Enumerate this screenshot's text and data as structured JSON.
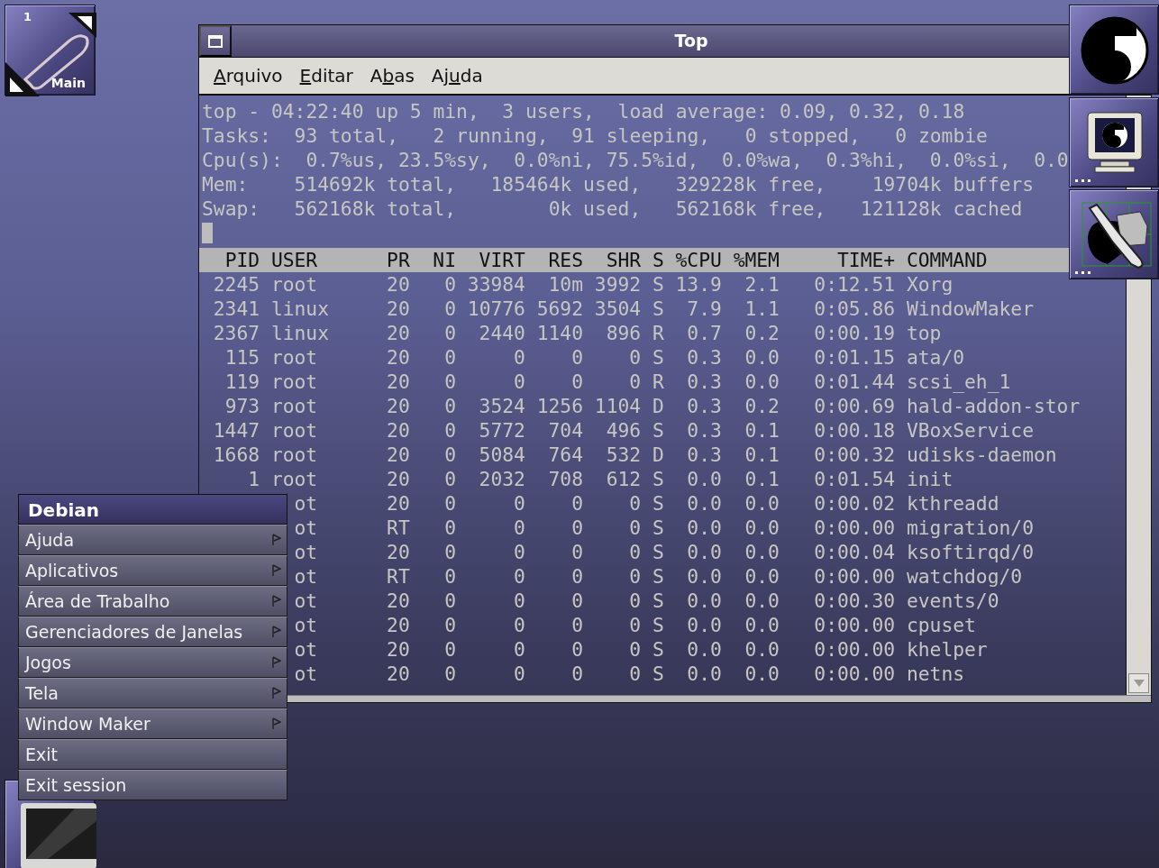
{
  "clip": {
    "workspace_number": "1",
    "workspace_name": "Main"
  },
  "window": {
    "title": "Top",
    "menu": [
      {
        "parts": [
          {
            "text": "A",
            "underline": true
          },
          {
            "text": "rquivo",
            "underline": false
          }
        ]
      },
      {
        "parts": [
          {
            "text": "E",
            "underline": true
          },
          {
            "text": "ditar",
            "underline": false
          }
        ]
      },
      {
        "parts": [
          {
            "text": "A",
            "underline": false
          },
          {
            "text": "b",
            "underline": true
          },
          {
            "text": "as",
            "underline": false
          }
        ]
      },
      {
        "parts": [
          {
            "text": "Aj",
            "underline": false
          },
          {
            "text": "u",
            "underline": true
          },
          {
            "text": "da",
            "underline": false
          }
        ]
      }
    ]
  },
  "terminal": {
    "summary_lines": [
      "top - 04:22:40 up 5 min,  3 users,  load average: 0.09, 0.32, 0.18",
      "Tasks:  93 total,   2 running,  91 sleeping,   0 stopped,   0 zombie",
      "Cpu(s):  0.7%us, 23.5%sy,  0.0%ni, 75.5%id,  0.0%wa,  0.3%hi,  0.0%si,  0.0",
      "Mem:    514692k total,   185464k used,   329228k free,    19704k buffers",
      "Swap:   562168k total,        0k used,   562168k free,   121128k cached"
    ],
    "columns": [
      "PID",
      "USER",
      "PR",
      "NI",
      "VIRT",
      "RES",
      "SHR",
      "S",
      "%CPU",
      "%MEM",
      "TIME+",
      "COMMAND"
    ],
    "rows": [
      {
        "pid": "2245",
        "user": "root",
        "pr": "20",
        "ni": "0",
        "virt": "33984",
        "res": "10m",
        "shr": "3992",
        "s": "S",
        "cpu": "13.9",
        "mem": "2.1",
        "time": "0:12.51",
        "command": "Xorg",
        "obscured": false
      },
      {
        "pid": "2341",
        "user": "linux",
        "pr": "20",
        "ni": "0",
        "virt": "10776",
        "res": "5692",
        "shr": "3504",
        "s": "S",
        "cpu": "7.9",
        "mem": "1.1",
        "time": "0:05.86",
        "command": "WindowMaker",
        "obscured": false
      },
      {
        "pid": "2367",
        "user": "linux",
        "pr": "20",
        "ni": "0",
        "virt": "2440",
        "res": "1140",
        "shr": "896",
        "s": "R",
        "cpu": "0.7",
        "mem": "0.2",
        "time": "0:00.19",
        "command": "top",
        "obscured": false
      },
      {
        "pid": "115",
        "user": "root",
        "pr": "20",
        "ni": "0",
        "virt": "0",
        "res": "0",
        "shr": "0",
        "s": "S",
        "cpu": "0.3",
        "mem": "0.0",
        "time": "0:01.15",
        "command": "ata/0",
        "obscured": false
      },
      {
        "pid": "119",
        "user": "root",
        "pr": "20",
        "ni": "0",
        "virt": "0",
        "res": "0",
        "shr": "0",
        "s": "R",
        "cpu": "0.3",
        "mem": "0.0",
        "time": "0:01.44",
        "command": "scsi_eh_1",
        "obscured": false
      },
      {
        "pid": "973",
        "user": "root",
        "pr": "20",
        "ni": "0",
        "virt": "3524",
        "res": "1256",
        "shr": "1104",
        "s": "D",
        "cpu": "0.3",
        "mem": "0.2",
        "time": "0:00.69",
        "command": "hald-addon-stor",
        "obscured": false
      },
      {
        "pid": "1447",
        "user": "root",
        "pr": "20",
        "ni": "0",
        "virt": "5772",
        "res": "704",
        "shr": "496",
        "s": "S",
        "cpu": "0.3",
        "mem": "0.1",
        "time": "0:00.18",
        "command": "VBoxService",
        "obscured": false
      },
      {
        "pid": "1668",
        "user": "root",
        "pr": "20",
        "ni": "0",
        "virt": "5084",
        "res": "764",
        "shr": "532",
        "s": "D",
        "cpu": "0.3",
        "mem": "0.1",
        "time": "0:00.32",
        "command": "udisks-daemon",
        "obscured": false
      },
      {
        "pid": "1",
        "user": "root",
        "pr": "20",
        "ni": "0",
        "virt": "2032",
        "res": "708",
        "shr": "612",
        "s": "S",
        "cpu": "0.0",
        "mem": "0.1",
        "time": "0:01.54",
        "command": "init",
        "obscured": false
      },
      {
        "user": "ot",
        "pr": "20",
        "ni": "0",
        "virt": "0",
        "res": "0",
        "shr": "0",
        "s": "S",
        "cpu": "0.0",
        "mem": "0.0",
        "time": "0:00.02",
        "command": "kthreadd",
        "obscured": true
      },
      {
        "user": "ot",
        "pr": "RT",
        "ni": "0",
        "virt": "0",
        "res": "0",
        "shr": "0",
        "s": "S",
        "cpu": "0.0",
        "mem": "0.0",
        "time": "0:00.00",
        "command": "migration/0",
        "obscured": true
      },
      {
        "user": "ot",
        "pr": "20",
        "ni": "0",
        "virt": "0",
        "res": "0",
        "shr": "0",
        "s": "S",
        "cpu": "0.0",
        "mem": "0.0",
        "time": "0:00.04",
        "command": "ksoftirqd/0",
        "obscured": true
      },
      {
        "user": "ot",
        "pr": "RT",
        "ni": "0",
        "virt": "0",
        "res": "0",
        "shr": "0",
        "s": "S",
        "cpu": "0.0",
        "mem": "0.0",
        "time": "0:00.00",
        "command": "watchdog/0",
        "obscured": true
      },
      {
        "user": "ot",
        "pr": "20",
        "ni": "0",
        "virt": "0",
        "res": "0",
        "shr": "0",
        "s": "S",
        "cpu": "0.0",
        "mem": "0.0",
        "time": "0:00.30",
        "command": "events/0",
        "obscured": true
      },
      {
        "user": "ot",
        "pr": "20",
        "ni": "0",
        "virt": "0",
        "res": "0",
        "shr": "0",
        "s": "S",
        "cpu": "0.0",
        "mem": "0.0",
        "time": "0:00.00",
        "command": "cpuset",
        "obscured": true
      },
      {
        "user": "ot",
        "pr": "20",
        "ni": "0",
        "virt": "0",
        "res": "0",
        "shr": "0",
        "s": "S",
        "cpu": "0.0",
        "mem": "0.0",
        "time": "0:00.00",
        "command": "khelper",
        "obscured": true
      },
      {
        "user": "ot",
        "pr": "20",
        "ni": "0",
        "virt": "0",
        "res": "0",
        "shr": "0",
        "s": "S",
        "cpu": "0.0",
        "mem": "0.0",
        "time": "0:00.00",
        "command": "netns",
        "obscured": true
      }
    ]
  },
  "root_menu": {
    "title": "Debian",
    "items": [
      {
        "label": "Ajuda",
        "kind": "submenu"
      },
      {
        "label": "Aplicativos",
        "kind": "submenu"
      },
      {
        "label": "Área de Trabalho",
        "kind": "submenu"
      },
      {
        "label": "Gerenciadores de Janelas",
        "kind": "submenu"
      },
      {
        "label": "Jogos",
        "kind": "submenu"
      },
      {
        "label": "Tela",
        "kind": "submenu"
      },
      {
        "label": "Window Maker",
        "kind": "submenu"
      },
      {
        "label": "Exit",
        "kind": "command"
      },
      {
        "label": "Exit session",
        "kind": "command"
      }
    ]
  }
}
